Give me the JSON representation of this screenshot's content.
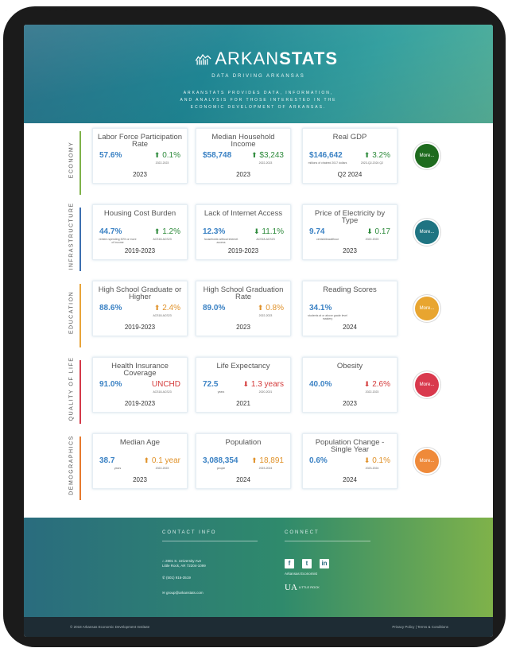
{
  "header": {
    "brand_light": "ARKAN",
    "brand_bold": "STATS",
    "tagline": "DATA DRIVING ARKANSAS",
    "description": "ARKANSTATS PROVIDES DATA, INFORMATION, AND ANALYSIS FOR THOSE INTERESTED IN THE ECONOMIC DEVELOPMENT OF ARKANSAS."
  },
  "sections": [
    {
      "label": "ECONOMY",
      "color": "#7fb24a",
      "more_label": "More...",
      "more_color": "#1e6b1e",
      "cards": [
        {
          "title": "Labor Force Participation Rate",
          "value": "57.6%",
          "value_sub": "",
          "change": "0.1%",
          "change_sub": "2022-2023",
          "year": "2023"
        },
        {
          "title": "Median Household Income",
          "value": "$58,748",
          "value_sub": "",
          "change": "$3,243",
          "change_sub": "2022-2023",
          "year": "2023"
        },
        {
          "title": "Real GDP",
          "value": "$146,642",
          "value_sub": "millions of chained 2017 dollars",
          "change": "3.2%",
          "change_sub": "2023-Q2-2024 Q2",
          "year": "Q2 2024"
        }
      ]
    },
    {
      "label": "INFRASTRUCTURE",
      "color": "#3d6fb0",
      "more_label": "More...",
      "more_color": "#1f7482",
      "cards": [
        {
          "title": "Housing Cost Burden",
          "value": "44.7%",
          "value_sub": "renters spending 30% or more of income",
          "change": "1.2%",
          "change_sub": "ACS18-ACS23",
          "year": "2019-2023"
        },
        {
          "title": "Lack of Internet Access",
          "value": "12.3%",
          "value_sub": "households without internet access",
          "change": "11.1%",
          "change_sub": "ACS18-ACS23",
          "year": "2019-2023"
        },
        {
          "title": "Price of Electricity by Type",
          "value": "9.74",
          "value_sub": "cents/kilowatthour",
          "change": "0.17",
          "change_sub": "2022-2023",
          "year": "2023"
        }
      ]
    },
    {
      "label": "EDUCATION",
      "color": "#e8a43a",
      "more_label": "More...",
      "more_color": "#e8a530",
      "cards": [
        {
          "title": "High School Graduate or Higher",
          "value": "88.6%",
          "value_sub": "",
          "change": "2.4%",
          "change_sub": "ACS18-ACS23",
          "year": "2019-2023"
        },
        {
          "title": "High School Graduation Rate",
          "value": "89.0%",
          "value_sub": "",
          "change": "0.8%",
          "change_sub": "2022-2023",
          "year": "2023"
        },
        {
          "title": "Reading Scores",
          "value": "34.1%",
          "value_sub": "students at or above grade level mastery",
          "change": "",
          "change_sub": "",
          "year": "2024"
        }
      ]
    },
    {
      "label": "QUALITY OF LIFE",
      "color": "#d43a4a",
      "more_label": "More...",
      "more_color": "#d9394d",
      "cards": [
        {
          "title": "Health Insurance Coverage",
          "value": "91.0%",
          "value_sub": "",
          "change": "UNCHD",
          "change_sub": "ACS18-ACS23",
          "year": "2019-2023"
        },
        {
          "title": "Life Expectancy",
          "value": "72.5",
          "value_sub": "years",
          "change": "1.3 years",
          "change_sub": "2020-2021",
          "year": "2021"
        },
        {
          "title": "Obesity",
          "value": "40.0%",
          "value_sub": "",
          "change": "2.6%",
          "change_sub": "2022-2023",
          "year": "2023"
        }
      ]
    },
    {
      "label": "DEMOGRAPHICS",
      "color": "#e67a2e",
      "more_label": "More...",
      "more_color": "#ef8a3a",
      "cards": [
        {
          "title": "Median Age",
          "value": "38.7",
          "value_sub": "years",
          "change": "0.1 year",
          "change_sub": "2022-2023",
          "year": "2023"
        },
        {
          "title": "Population",
          "value": "3,088,354",
          "value_sub": "people",
          "change": "18,891",
          "change_sub": "2023-2024",
          "year": "2024"
        },
        {
          "title": "Population Change - Single Year",
          "value": "0.6%",
          "value_sub": "",
          "change": "0.1%",
          "change_sub": "2023-2024",
          "year": "2024"
        }
      ]
    }
  ],
  "footer": {
    "contact_heading": "CONTACT INFO",
    "connect_heading": "CONNECT",
    "address_line1": "2801 S. University Ave",
    "address_line2": "Little Rock, AR 72204-1099",
    "phone": "(501) 916-3519",
    "email": "group@arkanstats.com",
    "social_caption": "Arkansas Economist",
    "ualr_mark": "UA",
    "ualr_text": "LITTLE ROCK",
    "copyright": "© 2018 Arkansas Economic Development Institute",
    "legal": "Privacy Policy | Terms & Conditions"
  }
}
